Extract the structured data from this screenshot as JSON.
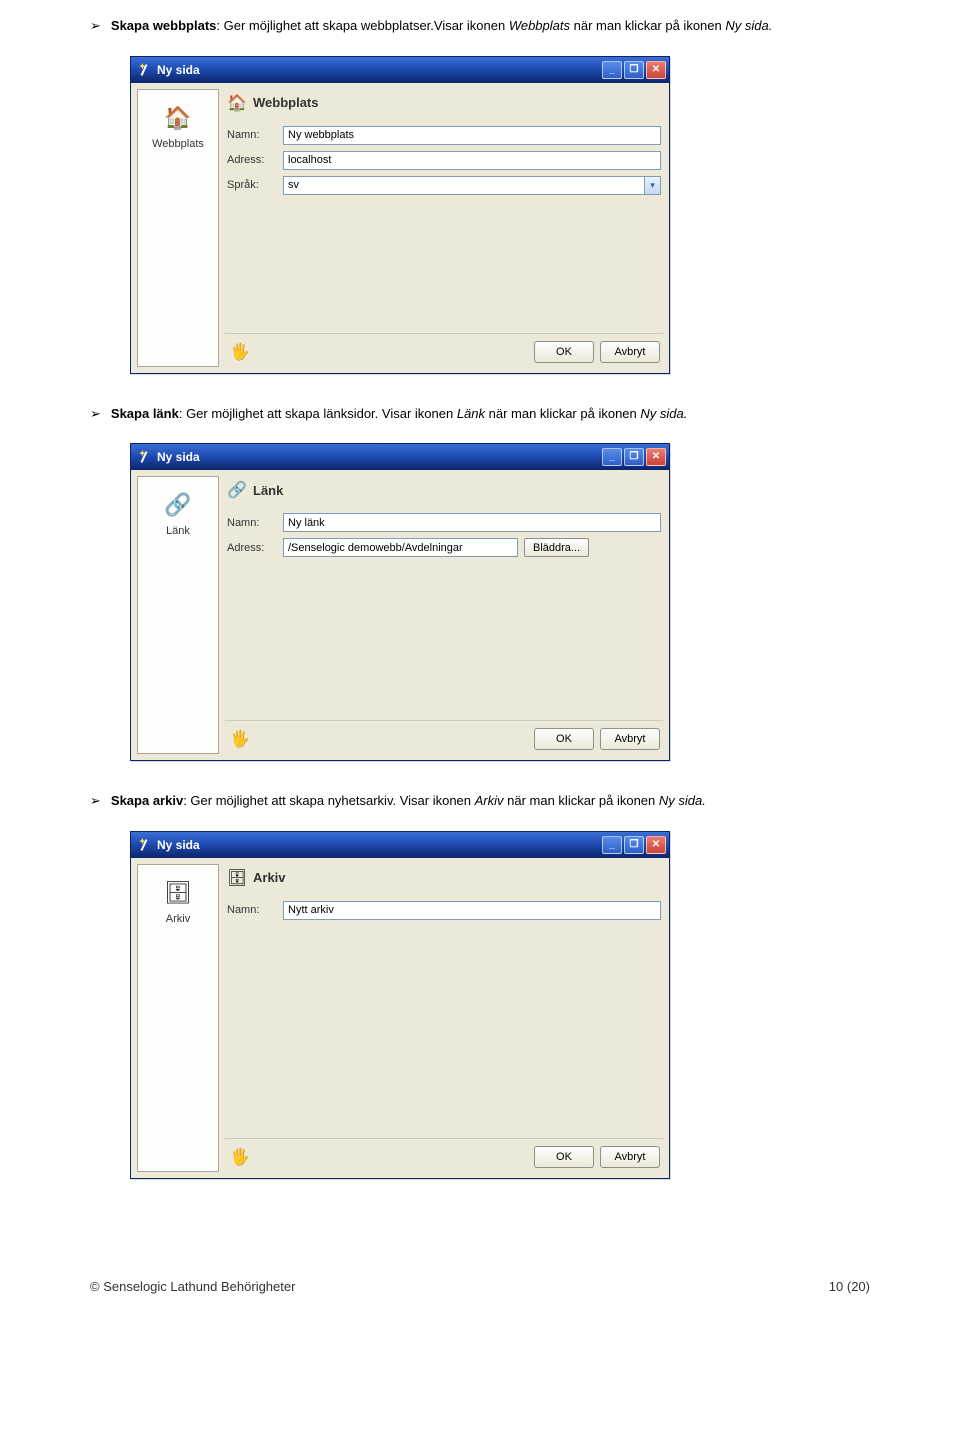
{
  "bullets": {
    "b1": {
      "bold": "Skapa webbplats",
      "rest": ": Ger möjlighet att skapa webbplatser.Visar ikonen ",
      "ital": "Webbplats",
      "rest2": " när man klickar på ikonen ",
      "ital2": "Ny sida."
    },
    "b2": {
      "bold": "Skapa länk",
      "rest": ": Ger möjlighet att skapa länksidor. Visar ikonen ",
      "ital": "Länk",
      "rest2": " när man klickar på ikonen ",
      "ital2": "Ny sida."
    },
    "b3": {
      "bold": "Skapa arkiv",
      "rest": ": Ger möjlighet att skapa nyhetsarkiv. Visar ikonen ",
      "ital": "Arkiv",
      "rest2": " när man klickar på ikonen ",
      "ital2": "Ny sida."
    }
  },
  "dialog_title": "Ny sida",
  "win_min": "_",
  "win_max": "❐",
  "win_close": "✕",
  "d1": {
    "sidebar_label": "Webbplats",
    "header": "Webbplats",
    "rows": {
      "namn_label": "Namn:",
      "namn_value": "Ny webbplats",
      "adress_label": "Adress:",
      "adress_value": "localhost",
      "sprak_label": "Språk:",
      "sprak_value": "sv"
    }
  },
  "d2": {
    "sidebar_label": "Länk",
    "header": "Länk",
    "rows": {
      "namn_label": "Namn:",
      "namn_value": "Ny länk",
      "adress_label": "Adress:",
      "adress_value": "/Senselogic demowebb/Avdelningar",
      "browse": "Bläddra..."
    }
  },
  "d3": {
    "sidebar_label": "Arkiv",
    "header": "Arkiv",
    "rows": {
      "namn_label": "Namn:",
      "namn_value": "Nytt arkiv"
    }
  },
  "buttons": {
    "ok": "OK",
    "cancel": "Avbryt"
  },
  "footer": {
    "left": "© Senselogic Lathund Behörigheter",
    "right": "10 (20)"
  }
}
